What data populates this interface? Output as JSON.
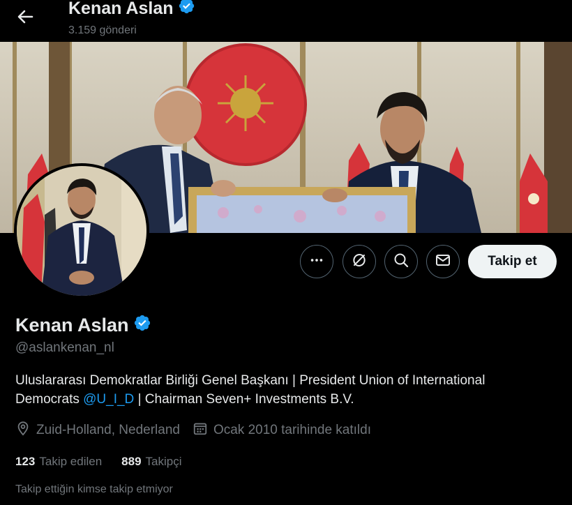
{
  "header": {
    "name": "Kenan Aslan",
    "post_count": "3.159 gönderi"
  },
  "profile": {
    "name": "Kenan Aslan",
    "handle": "@aslankenan_nl",
    "bio_line1": "Uluslararası Demokratlar Birliği Genel Başkanı | President Union of International",
    "bio_line2_prefix": "Democrats ",
    "bio_mention": "@U_I_D",
    "bio_line2_suffix": " | Chairman Seven+ Investments B.V.",
    "location": "Zuid-Holland, Nederland",
    "joined": "Ocak 2010 tarihinde katıldı",
    "following_count": "123",
    "following_label": "Takip edilen",
    "followers_count": "889",
    "followers_label": "Takipçi",
    "followed_by_note": "Takip ettiğin kimse takip etmiyor"
  },
  "actions": {
    "follow_label": "Takip et",
    "more_icon": "more-icon",
    "grok_icon": "grok-icon",
    "search_icon": "search-icon",
    "message_icon": "message-icon"
  },
  "colors": {
    "background": "#000000",
    "text": "#e7e9ea",
    "muted": "#71767b",
    "link": "#1d9bf0",
    "verified": "#1d9bf0",
    "follow_bg": "#eff3f4"
  }
}
